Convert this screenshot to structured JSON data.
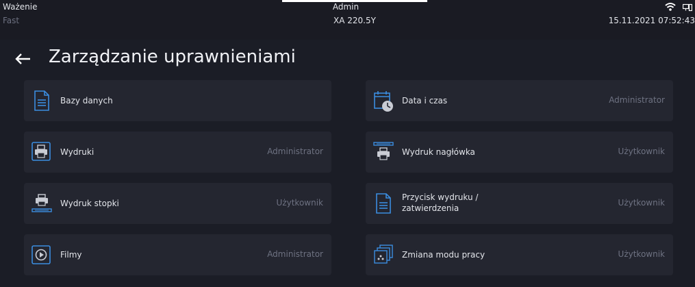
{
  "status": {
    "mode": "Ważenie",
    "submode": "Fast",
    "user": "Admin",
    "model": "XA 220.5Y",
    "datetime": "15.11.2021 07:52:43",
    "icons": [
      "wifi-icon",
      "network-icon"
    ]
  },
  "header": {
    "title": "Zarządzanie uprawnieniami",
    "back_icon": "arrow-left-icon"
  },
  "items": [
    {
      "label": "Bazy danych",
      "role": "",
      "icon": "document-icon"
    },
    {
      "label": "Data i czas",
      "role": "Administrator",
      "icon": "calendar-clock-icon"
    },
    {
      "label": "Wydruki",
      "role": "Administrator",
      "icon": "printer-icon"
    },
    {
      "label": "Wydruk nagłówka",
      "role": "Użytkownik",
      "icon": "printer-header-icon"
    },
    {
      "label": "Wydruk stopki",
      "role": "Użytkownik",
      "icon": "printer-footer-icon"
    },
    {
      "label_line1": "Przycisk wydruku /",
      "label_line2": "zatwierdzenia",
      "role": "Użytkownik",
      "icon": "document-icon"
    },
    {
      "label": "Filmy",
      "role": "Administrator",
      "icon": "play-icon"
    },
    {
      "label": "Zmiana modu pracy",
      "role": "Użytkownik",
      "icon": "stacked-cards-icon"
    }
  ],
  "colors": {
    "background": "#1b1d26",
    "card": "#242630",
    "accent": "#3b8de0",
    "muted_text": "#6e7282"
  }
}
